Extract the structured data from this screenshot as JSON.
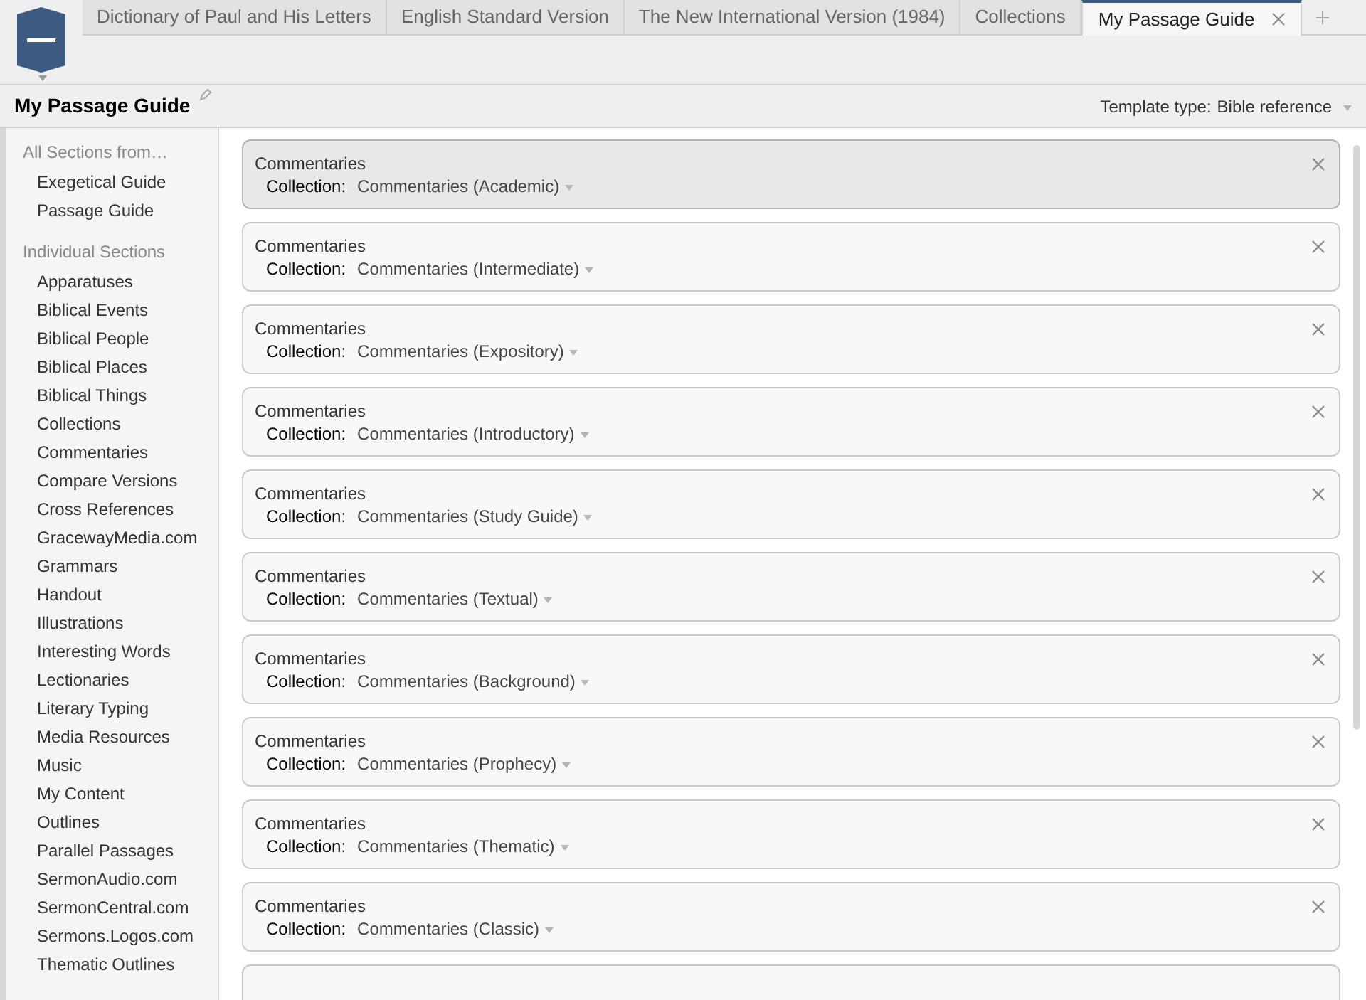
{
  "tabs": [
    {
      "label": "Dictionary of Paul and His Letters",
      "selected": false
    },
    {
      "label": "English Standard Version",
      "selected": false
    },
    {
      "label": "The New International Version (1984)",
      "selected": false
    },
    {
      "label": "Collections",
      "selected": false
    },
    {
      "label": "My Passage Guide",
      "selected": true,
      "closable": true
    }
  ],
  "guide": {
    "title": "My Passage Guide",
    "template_label": "Template type:",
    "template_value": "Bible reference"
  },
  "sidebar": {
    "groups": [
      {
        "heading": "All Sections from…",
        "items": [
          "Exegetical Guide",
          "Passage Guide"
        ]
      },
      {
        "heading": "Individual Sections",
        "items": [
          "Apparatuses",
          "Biblical Events",
          "Biblical People",
          "Biblical Places",
          "Biblical Things",
          "Collections",
          "Commentaries",
          "Compare Versions",
          "Cross References",
          "GracewayMedia.com",
          "Grammars",
          "Handout",
          "Illustrations",
          "Interesting Words",
          "Lectionaries",
          "Literary Typing",
          "Media Resources",
          "Music",
          "My Content",
          "Outlines",
          "Parallel Passages",
          "SermonAudio.com",
          "SermonCentral.com",
          "Sermons.Logos.com",
          "Thematic Outlines"
        ]
      }
    ]
  },
  "sections": [
    {
      "title": "Commentaries",
      "field_label": "Collection:",
      "value": "Commentaries (Academic)",
      "selected": true
    },
    {
      "title": "Commentaries",
      "field_label": "Collection:",
      "value": "Commentaries (Intermediate)",
      "selected": false
    },
    {
      "title": "Commentaries",
      "field_label": "Collection:",
      "value": "Commentaries (Expository)",
      "selected": false
    },
    {
      "title": "Commentaries",
      "field_label": "Collection:",
      "value": "Commentaries (Introductory)",
      "selected": false
    },
    {
      "title": "Commentaries",
      "field_label": "Collection:",
      "value": "Commentaries (Study Guide)",
      "selected": false
    },
    {
      "title": "Commentaries",
      "field_label": "Collection:",
      "value": "Commentaries (Textual)",
      "selected": false
    },
    {
      "title": "Commentaries",
      "field_label": "Collection:",
      "value": "Commentaries (Background)",
      "selected": false
    },
    {
      "title": "Commentaries",
      "field_label": "Collection:",
      "value": "Commentaries (Prophecy)",
      "selected": false
    },
    {
      "title": "Commentaries",
      "field_label": "Collection:",
      "value": "Commentaries (Thematic)",
      "selected": false
    },
    {
      "title": "Commentaries",
      "field_label": "Collection:",
      "value": "Commentaries (Classic)",
      "selected": false
    }
  ]
}
